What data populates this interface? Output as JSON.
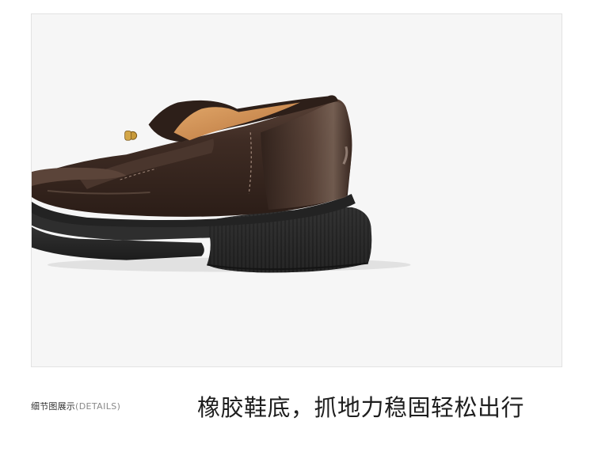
{
  "section_label": {
    "zh": "细节图展示",
    "en": "(DETAILS)"
  },
  "caption": "橡胶鞋底，抓地力稳固轻松出行",
  "colors": {
    "leather": "#3c2a22",
    "sole": "#2a2a2a",
    "lining": "#c98b50",
    "buckle": "#c89a3a",
    "frame_border": "#e2e2e2",
    "frame_bg": "#f6f6f6"
  },
  "image": {
    "subject": "brown loafer shoe close-up",
    "icon": "shoe-photo"
  }
}
